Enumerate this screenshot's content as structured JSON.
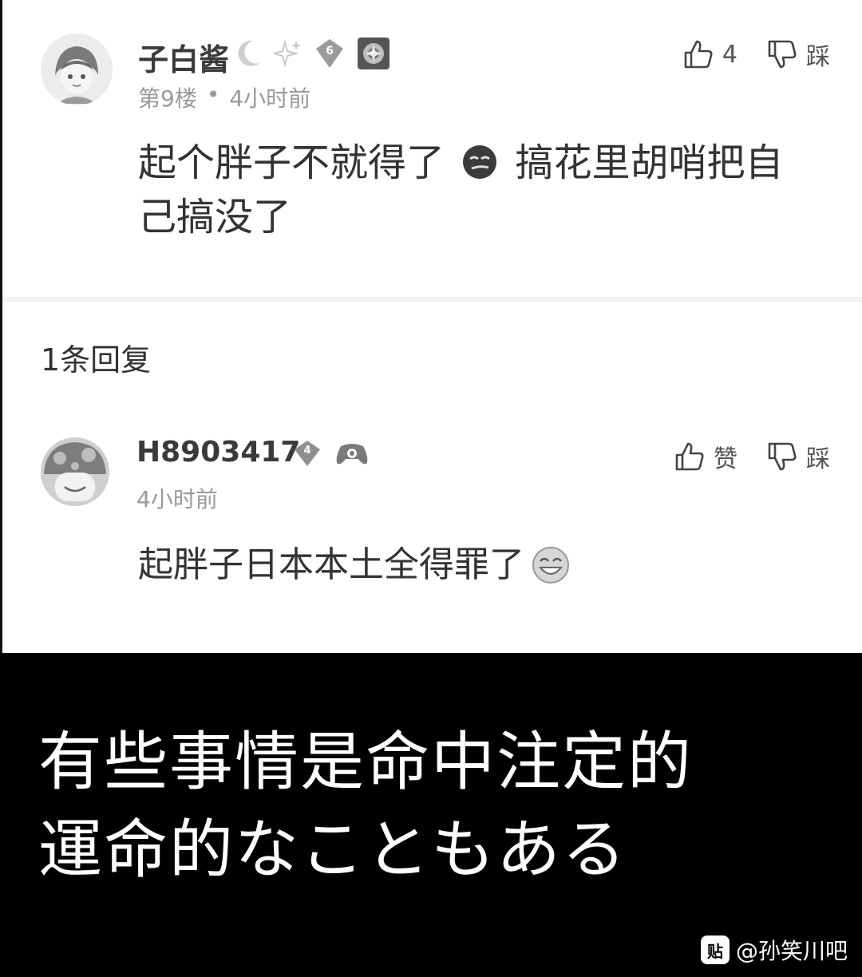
{
  "main_comment": {
    "username": "子白酱",
    "level_badge": "6",
    "floor": "第9楼",
    "separator": "•",
    "time": "4小时前",
    "content_before_emoji": "起个胖子不就得了",
    "content_after_emoji": "搞花里胡哨把自己搞没了",
    "like_count": "4",
    "dislike_label": "踩"
  },
  "reply_section": {
    "count_label": "1条回复"
  },
  "reply_comment": {
    "username": "H8903417",
    "level_badge": "4",
    "time": "4小时前",
    "content": "起胖子日本本土全得罪了",
    "like_label": "赞",
    "dislike_label": "踩"
  },
  "caption": {
    "line1": "有些事情是命中注定的",
    "line2": "運命的なこともある"
  },
  "watermark": {
    "logo_text": "贴",
    "text": "@孙笑川吧"
  },
  "colors": {
    "background": "#ffffff",
    "caption_band": "#000000",
    "meta_text": "#9a9a9a"
  }
}
